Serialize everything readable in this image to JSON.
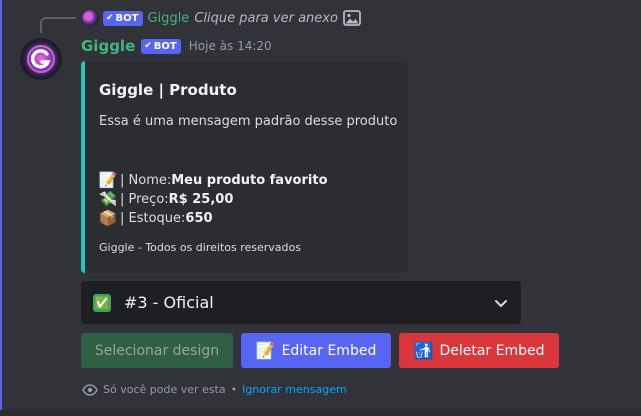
{
  "reply": {
    "username": "Giggle",
    "bot_tag": "BOT",
    "text": "Clique para ver anexo"
  },
  "message": {
    "username": "Giggle",
    "bot_tag": "BOT",
    "timestamp": "Hoje às 14:20"
  },
  "embed": {
    "title": "Giggle | Produto",
    "description": "Essa é uma mensagem padrão desse produto",
    "accent_color": "#23c9b6",
    "fields": [
      {
        "emoji": "📝",
        "label": " | Nome: ",
        "value": "Meu produto favorito"
      },
      {
        "emoji": "💸",
        "label": " | Preço: ",
        "value": "R$ 25,00"
      },
      {
        "emoji": "📦",
        "label": " | Estoque: ",
        "value": "650"
      }
    ],
    "footer": "Giggle - Todos os direitos reservados"
  },
  "select_menu": {
    "emoji": "✅",
    "value": "#3 - Oficial"
  },
  "buttons": {
    "select_design": "Selecionar design",
    "edit_embed_emoji": "📝",
    "edit_embed": "Editar Embed",
    "delete_embed_emoji": "🚮",
    "delete_embed": "Deletar Embed"
  },
  "ephemeral": {
    "text": "Só você pode ver esta",
    "separator": "•",
    "link": "Ignorar mensagem"
  },
  "colors": {
    "background": "#323339",
    "embed_bg": "#2b2d31",
    "username": "#43b581",
    "blurple": "#5865f2",
    "danger": "#da373c",
    "success_disabled": "#2f5f45",
    "link": "#00a8fc"
  }
}
